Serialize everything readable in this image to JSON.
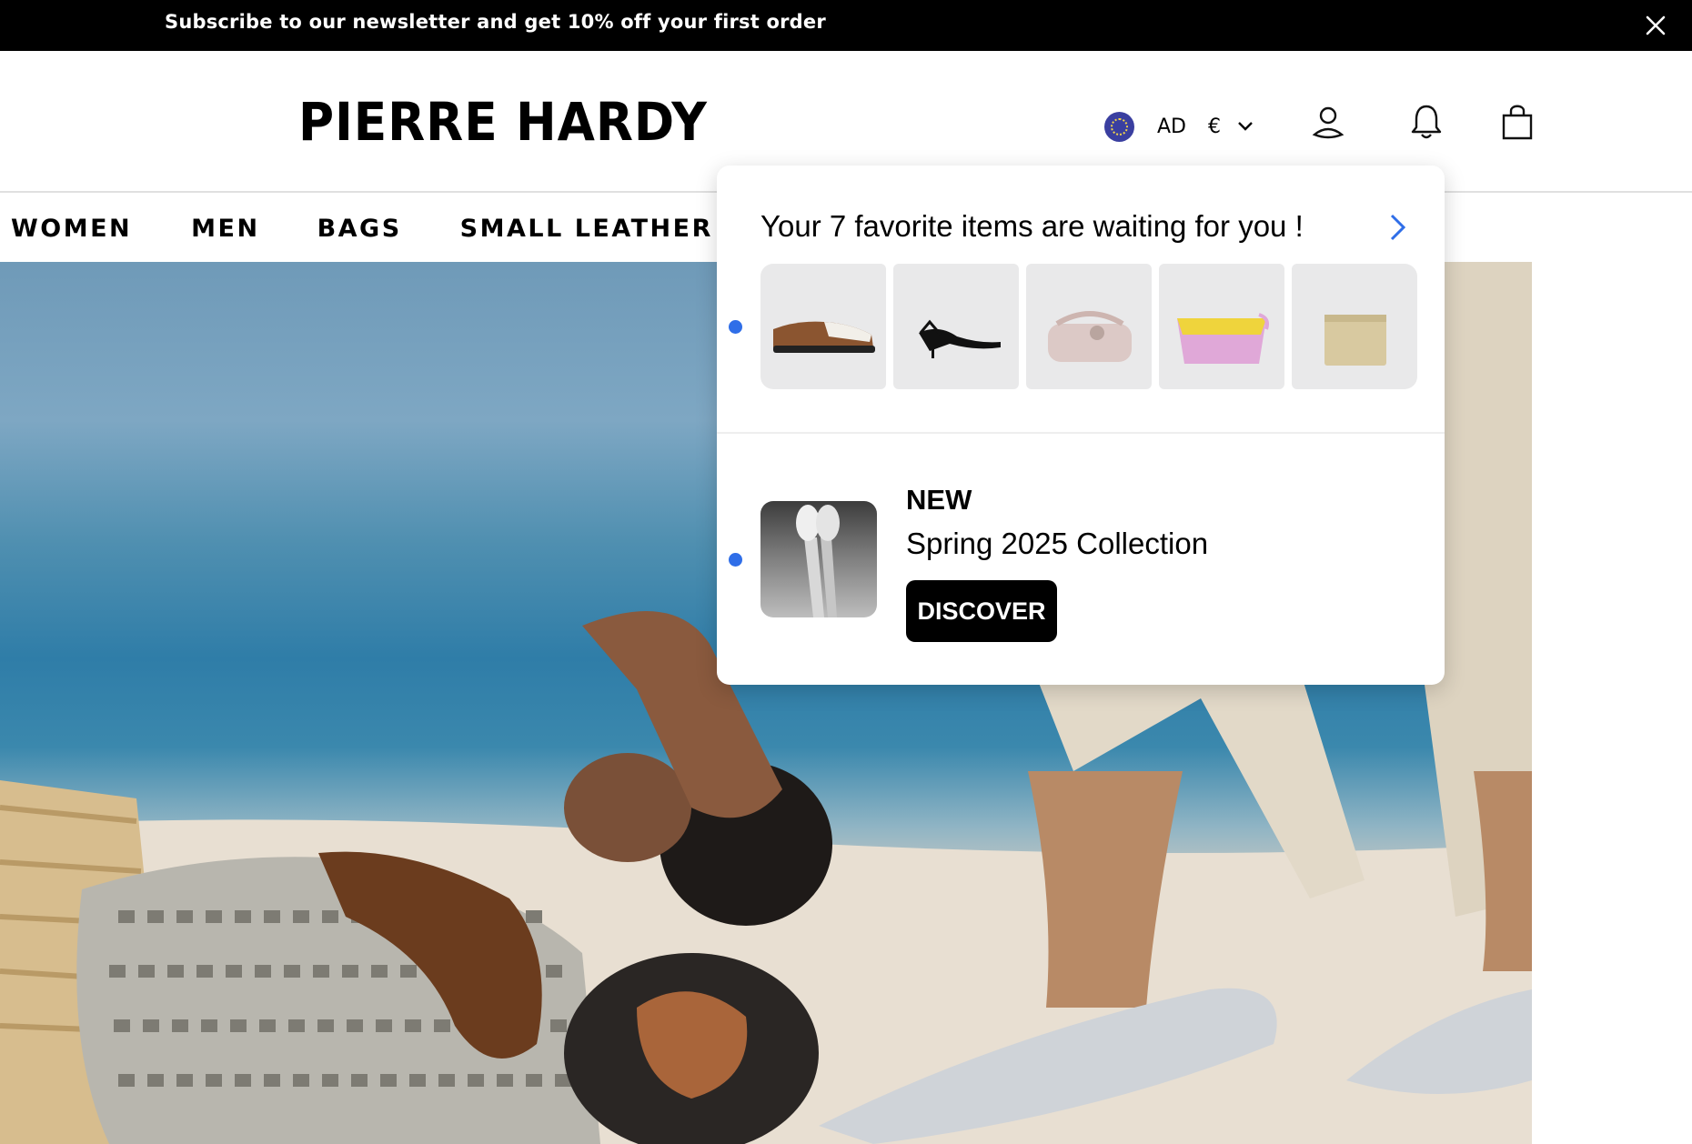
{
  "promo_bar": {
    "text": "Subscribe to our newsletter and get 10% off your first order",
    "close_icon": "close-icon"
  },
  "header": {
    "logo": "PIERRE HARDY",
    "region": {
      "flag_icon": "eu-flag-icon",
      "country": "AD",
      "currency": "€",
      "dropdown_icon": "chevron-down-icon"
    },
    "icons": [
      "account-icon",
      "bell-icon",
      "bag-icon"
    ]
  },
  "nav": {
    "items": [
      {
        "label": "WOMEN"
      },
      {
        "label": "MEN"
      },
      {
        "label": "BAGS"
      },
      {
        "label": "SMALL LEATHER GOODS"
      }
    ]
  },
  "popup": {
    "favorites": {
      "title": "Your 7 favorite items are waiting for you !",
      "arrow_icon": "chevron-right-icon",
      "items": [
        "loafer",
        "sandal",
        "bag",
        "pouch",
        "wallet"
      ]
    },
    "collection": {
      "badge": "NEW",
      "title": "Spring 2025 Collection",
      "button": "DISCOVER"
    },
    "unread_dot_color": "#2f6ee8"
  },
  "colors": {
    "promo_bg": "#000000",
    "button_bg": "#000000",
    "accent": "#2f6ee8"
  }
}
